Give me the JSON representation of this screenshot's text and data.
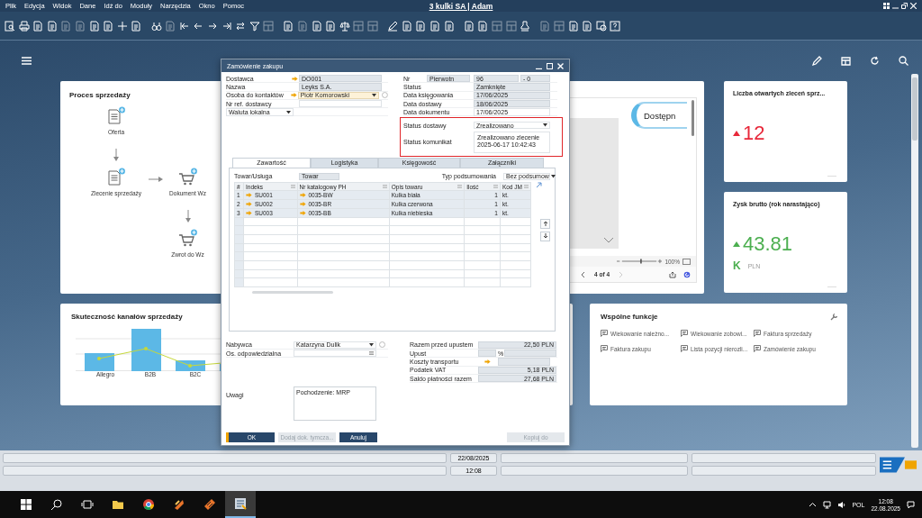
{
  "menubar": {
    "items": [
      "Plik",
      "Edycja",
      "Widok",
      "Dane",
      "Idź do",
      "Moduły",
      "Narzędzia",
      "Okno",
      "Pomoc"
    ],
    "title": "3 kulki SA | Adam"
  },
  "process_card": {
    "title": "Proces sprzedaży",
    "steps": [
      {
        "label": "Oferta",
        "kind": "document"
      },
      {
        "label": "Zlecenie sprzedaży",
        "kind": "document"
      },
      {
        "label": "Dokument Wz",
        "kind": "cart"
      },
      {
        "label": "Zwrot do Wz",
        "kind": "cart"
      }
    ]
  },
  "report_card": {
    "button": "Dostępn",
    "zoom_slider": {
      "level": 0.55
    },
    "zoom": "100%",
    "pager": "4 of 4"
  },
  "kpi_cards": [
    {
      "title": "Liczba otwartych zleceń sprz...",
      "value": "12",
      "rising": true,
      "color": "#e8283a"
    },
    {
      "title": "Zysk brutto (rok narastająco)",
      "value": "43.81",
      "rising": true,
      "color": "#4caf50",
      "scale": "K",
      "unit": "PLN"
    }
  ],
  "channel_card": {
    "title": "Skuteczność kanałów sprzedaży",
    "axis_labels": [
      "Allegro",
      "B2B",
      "B2C"
    ]
  },
  "functions_card": {
    "title": "Wspólne funkcje",
    "items": [
      "Wiekowanie należno...",
      "Wiekowanie zobowi...",
      "Faktura sprzedaży",
      "Faktura zakupu",
      "Lista pozycji nierozli...",
      "Zamówienie zakupu"
    ]
  },
  "dialog": {
    "title": "Zamówienie zakupu",
    "header_left": [
      {
        "label": "Dostawca",
        "value": "DO001",
        "kind": "link"
      },
      {
        "label": "Nazwa",
        "value": "Leyks S.A.",
        "kind": "readonly"
      },
      {
        "label": "Osoba do kontaktów",
        "value": "Piotr Komorowski",
        "kind": "link-dropdown"
      },
      {
        "label": "Nr ref. dostawcy",
        "kind": "input"
      }
    ],
    "currency": "Waluta lokalna",
    "number": {
      "label": "Nr",
      "series": "Pierwotn",
      "value": "96",
      "suffix": "- 0"
    },
    "header_right": [
      {
        "label": "Status",
        "value": "Zamknięte",
        "kind": "readonly"
      },
      {
        "label": "Data księgowania",
        "value": "17/06/2025",
        "kind": "readonly"
      },
      {
        "label": "Data dostawy",
        "value": "18/06/2025",
        "kind": "readonly"
      },
      {
        "label": "Data dokumentu",
        "value": "17/06/2025",
        "kind": "input"
      }
    ],
    "delivery_status": {
      "label": "Status dostawy",
      "value": "Zrealizowano"
    },
    "status_message": {
      "label": "Status komunikat",
      "lines": [
        "Zrealizowano zlecenie",
        "2025-06-17 10:42:43"
      ]
    },
    "tabs": [
      {
        "label": "Zawartość",
        "selected": true
      },
      {
        "label": "Logistyka",
        "selected": false
      },
      {
        "label": "Księgowość",
        "selected": false
      },
      {
        "label": "Załączniki",
        "selected": false
      }
    ],
    "item_type": {
      "label": "Towar/Usługa",
      "value": "Towar"
    },
    "summary_type": {
      "label": "Typ podsumowania",
      "value": "Bez podsumow"
    },
    "table": {
      "columns": [
        "#",
        "Indeks",
        "Nr katalogowy PH",
        "Opis towaru",
        "Ilość",
        "Kod JM"
      ],
      "rows": [
        [
          "1",
          "SU001",
          "0035-BW",
          "Kulka biała",
          "1",
          "kt."
        ],
        [
          "2",
          "SU002",
          "0035-BR",
          "Kulka czerwona",
          "1",
          "kt."
        ],
        [
          "3",
          "SU003",
          "0035-BB",
          "Kulka niebieska",
          "1",
          "kt."
        ]
      ]
    },
    "buyer": {
      "label": "Nabywca",
      "value": "Katarzyna Dulik"
    },
    "owner": {
      "label": "Os. odpowiedzialna"
    },
    "remarks": {
      "label": "Uwagi",
      "value": "Pochodzenie: MRP"
    },
    "totals": [
      {
        "label": "Razem przed upustem",
        "value": "22,50 PLN",
        "kind": "amount"
      },
      {
        "label": "Upust",
        "unit": "%",
        "kind": "percent"
      },
      {
        "label": "Koszty transportu",
        "kind": "link"
      },
      {
        "label": "Podatek VAT",
        "value": "5,18 PLN",
        "kind": "amount"
      },
      {
        "label": "Saldo płatności razem",
        "value": "27,68 PLN",
        "kind": "amount"
      }
    ],
    "buttons": [
      {
        "label": "OK",
        "disabled": false,
        "kind": "primary"
      },
      {
        "label": "Dodaj dok. tymcza...",
        "disabled": true,
        "kind": "secondary"
      },
      {
        "label": "Anuluj",
        "disabled": false,
        "kind": "secondary"
      },
      {
        "label": "Kopiuj do",
        "disabled": true,
        "kind": "right"
      }
    ]
  },
  "status_bar": {
    "date": "22/08/2025",
    "time": "12:08"
  },
  "taskbar": {
    "language": "POL",
    "time": "12:08",
    "date": "22.08.2025"
  }
}
